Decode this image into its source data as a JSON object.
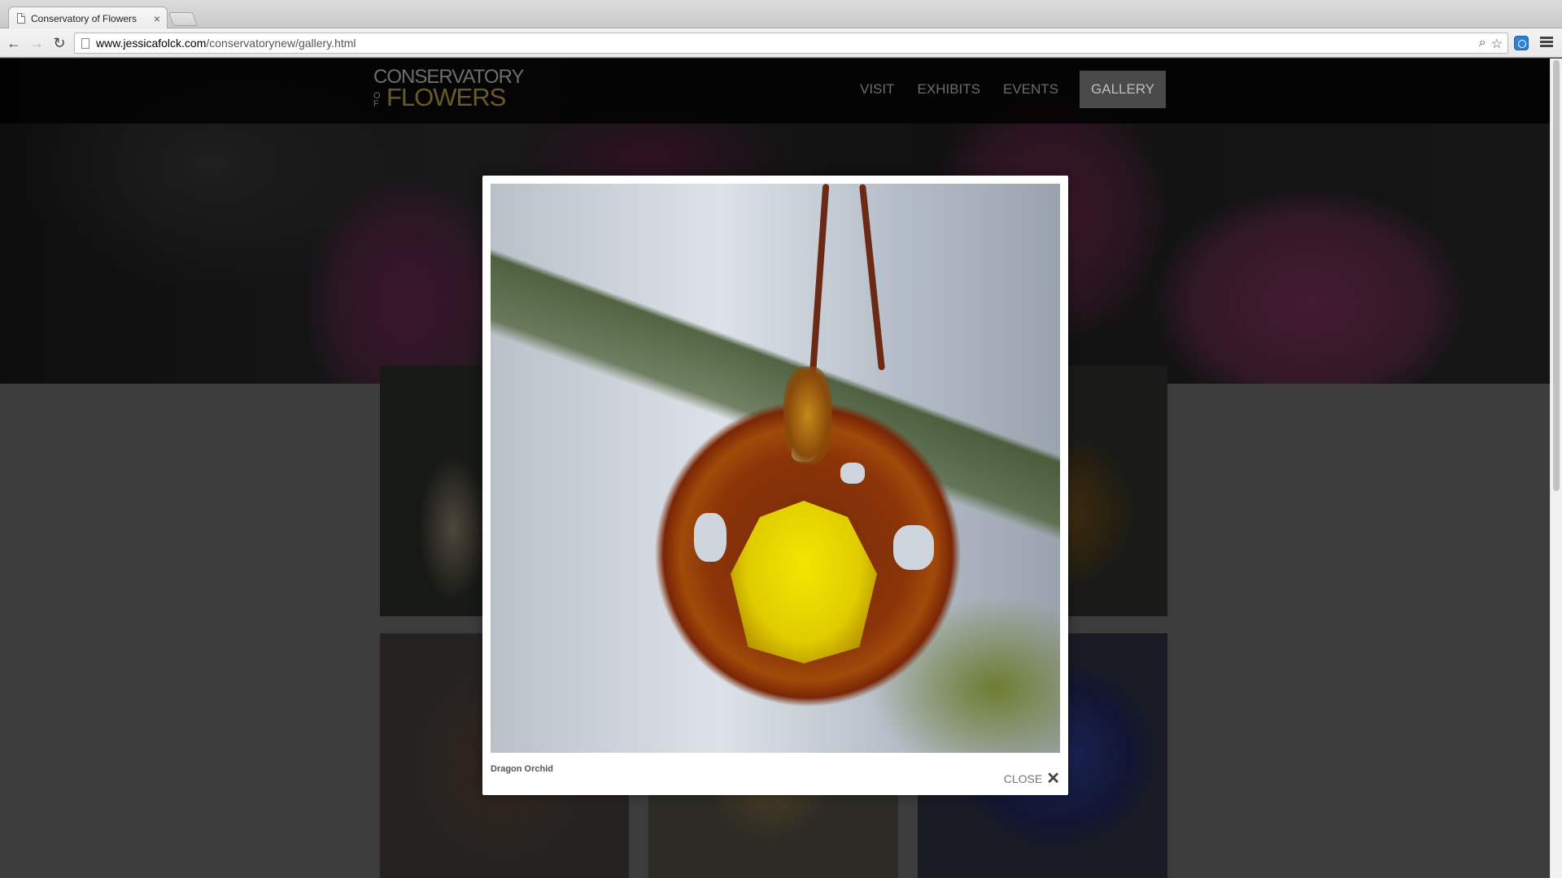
{
  "browser": {
    "tab_title": "Conservatory of Flowers",
    "tab_close": "×",
    "url_domain": "www.jessicafolck.com",
    "url_path": "/conservatorynew/gallery.html",
    "back_icon": "←",
    "forward_icon": "→",
    "reload_icon": "↻",
    "zoom_icon": "⌕",
    "star_icon": "☆"
  },
  "site": {
    "logo_line1": "CONSERVATORY",
    "logo_of": "OF",
    "logo_flowers": "FLOWERS",
    "nav": [
      {
        "label": "VISIT"
      },
      {
        "label": "EXHIBITS"
      },
      {
        "label": "EVENTS"
      },
      {
        "label": "GALLERY"
      }
    ],
    "active_nav": "GALLERY"
  },
  "lightbox": {
    "caption": "Dragon Orchid",
    "close_label": "CLOSE",
    "close_icon": "✕"
  }
}
